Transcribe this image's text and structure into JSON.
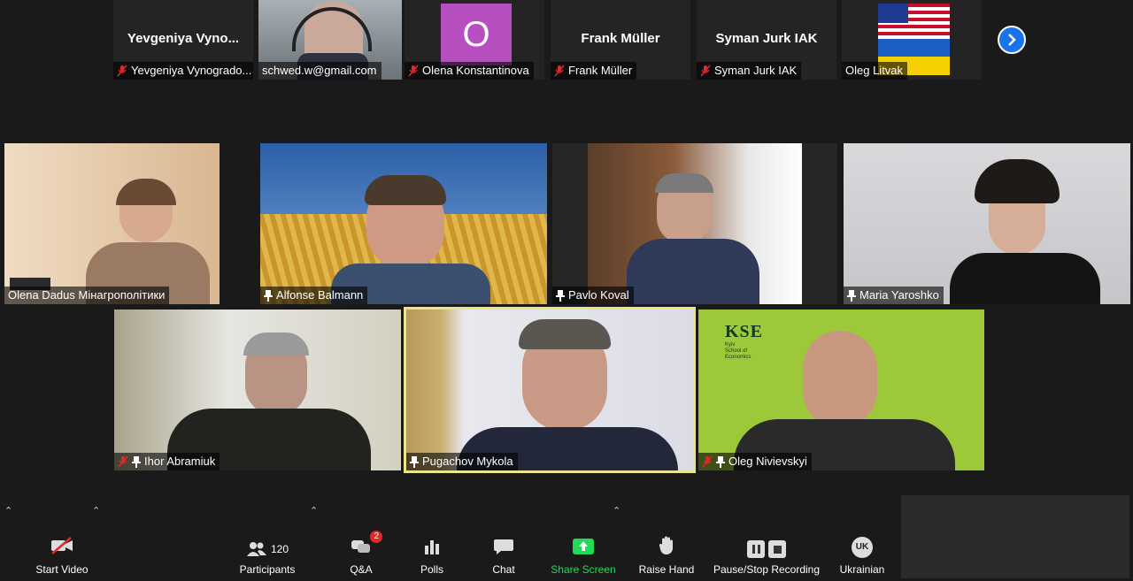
{
  "strip": {
    "tiles": [
      {
        "display": "Yevgeniya  Vyno...",
        "label": "Yevgeniya Vynogrado...",
        "muted": true
      },
      {
        "display": "",
        "label": "schwed.w@gmail.com",
        "muted": false
      },
      {
        "display": "O",
        "label": "Olena Konstantinova",
        "muted": true
      },
      {
        "display": "Frank Müller",
        "label": "Frank Müller",
        "muted": true
      },
      {
        "display": "Syman Jurk IAK",
        "label": "Syman Jurk IAK",
        "muted": true
      },
      {
        "display": "",
        "label": "Oleg Litvak",
        "muted": false
      }
    ],
    "next_icon": "chevron-right-icon",
    "avatar_color": "#b84fc0"
  },
  "grid": {
    "row1": [
      {
        "name": "Olena Dadus Мінагрополітики",
        "muted": false,
        "pinned": false
      },
      {
        "name": "Alfonse Balmann",
        "muted": false,
        "pinned": true
      },
      {
        "name": "Pavlo Koval",
        "muted": false,
        "pinned": true
      },
      {
        "name": "Maria Yaroshko",
        "muted": false,
        "pinned": true
      }
    ],
    "row2": [
      {
        "name": "Ihor Abramiuk",
        "muted": true,
        "pinned": true
      },
      {
        "name": "Pugachov Mykola",
        "muted": false,
        "pinned": true
      },
      {
        "name": "Oleg Nivievskyi",
        "muted": true,
        "pinned": true
      }
    ],
    "kse_logo": {
      "title": "KSE",
      "line1": "Kyiv",
      "line2": "School of",
      "line3": "Economics"
    }
  },
  "toolbar": {
    "start_video": "Start Video",
    "participants": "Participants",
    "participants_count": "120",
    "qa": "Q&A",
    "qa_badge": "2",
    "polls": "Polls",
    "chat": "Chat",
    "share_screen": "Share Screen",
    "raise_hand": "Raise Hand",
    "recording": "Pause/Stop Recording",
    "language": "Ukrainian",
    "language_code": "UK"
  },
  "colors": {
    "share_green": "#23d959",
    "active_speaker": "#e8e58a",
    "badge_red": "#e02828",
    "accent_blue": "#1a73e8"
  }
}
